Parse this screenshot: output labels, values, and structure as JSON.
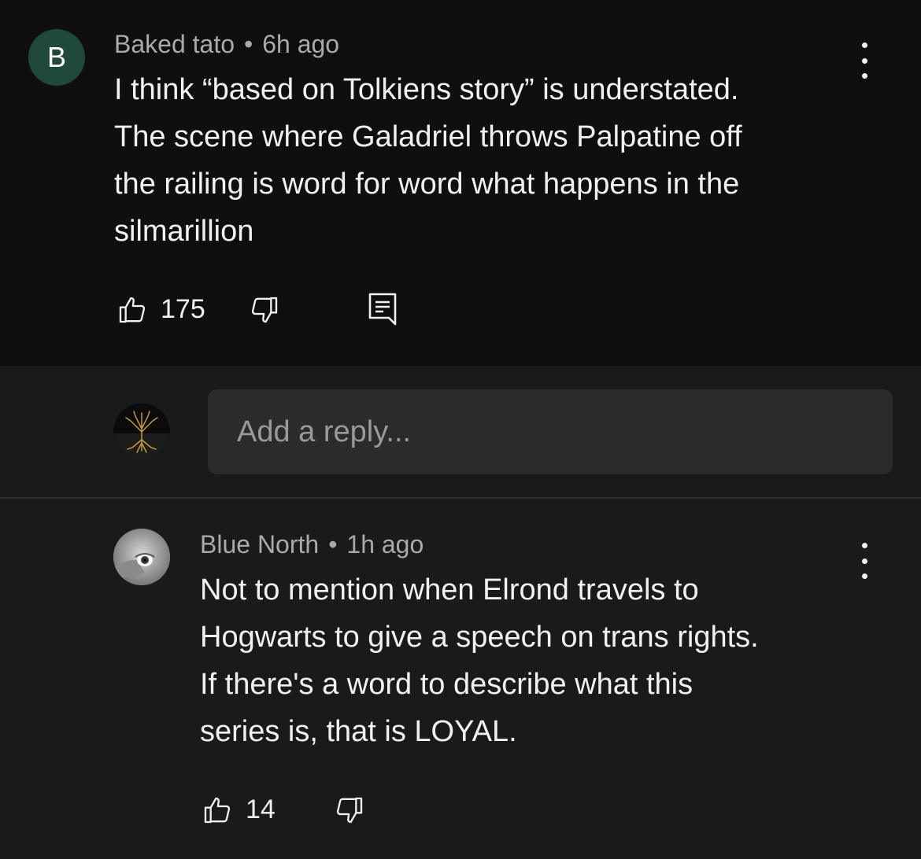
{
  "comment": {
    "author": "Baked tato",
    "avatar_letter": "B",
    "separator": "•",
    "time": "6h ago",
    "lines": [
      "I think “based on Tolkiens story” is understated.",
      "The scene where Galadriel throws Palpatine off",
      "the railing is word for word what happens in the",
      "silmarillion"
    ],
    "like_count": "175",
    "icons": {
      "like": "thumbs-up-icon",
      "dislike": "thumbs-down-icon",
      "reply": "comment-icon",
      "menu": "more-vert-icon"
    }
  },
  "reply_box": {
    "placeholder": "Add a reply..."
  },
  "reply": {
    "author": "Blue North",
    "separator": "•",
    "time": "1h ago",
    "lines": [
      "Not to mention when Elrond travels to",
      "Hogwarts to give a speech on trans rights.",
      "If there's a word to describe what this",
      "series is, that is LOYAL."
    ],
    "like_count": "14"
  },
  "colors": {
    "background": "#0f0f0f",
    "reply_background": "#1a1a1a",
    "avatar_b": "#1f4a3b",
    "secondary_text": "#aaaaaa"
  }
}
